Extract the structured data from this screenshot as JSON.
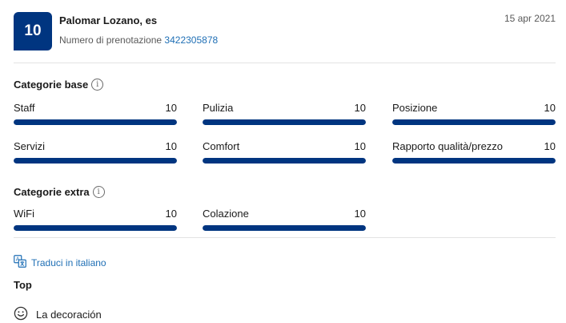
{
  "colors": {
    "accent": "#003580",
    "link": "#1f6fb5",
    "bar_track": "#e6e6e6",
    "muted_text": "#595959"
  },
  "review": {
    "score": "10",
    "reviewer_name": "Palomar Lozano, es",
    "booking_label": "Numero di prenotazione",
    "booking_number": "3422305878",
    "date": "15 apr 2021"
  },
  "base_categories": {
    "title": "Categorie base",
    "info_icon": "info-icon",
    "items": [
      {
        "label": "Staff",
        "score": "10",
        "fraction": 1.0
      },
      {
        "label": "Pulizia",
        "score": "10",
        "fraction": 1.0
      },
      {
        "label": "Posizione",
        "score": "10",
        "fraction": 1.0
      },
      {
        "label": "Servizi",
        "score": "10",
        "fraction": 1.0
      },
      {
        "label": "Comfort",
        "score": "10",
        "fraction": 1.0
      },
      {
        "label": "Rapporto qualità/prezzo",
        "score": "10",
        "fraction": 1.0
      }
    ]
  },
  "extra_categories": {
    "title": "Categorie extra",
    "info_icon": "info-icon",
    "items": [
      {
        "label": "WiFi",
        "score": "10",
        "fraction": 1.0
      },
      {
        "label": "Colazione",
        "score": "10",
        "fraction": 1.0
      }
    ]
  },
  "translate": {
    "icon": "translate-icon",
    "label": "Traduci in italiano"
  },
  "top": {
    "title": "Top",
    "icon": "smiley-icon",
    "text": "La decoración"
  }
}
